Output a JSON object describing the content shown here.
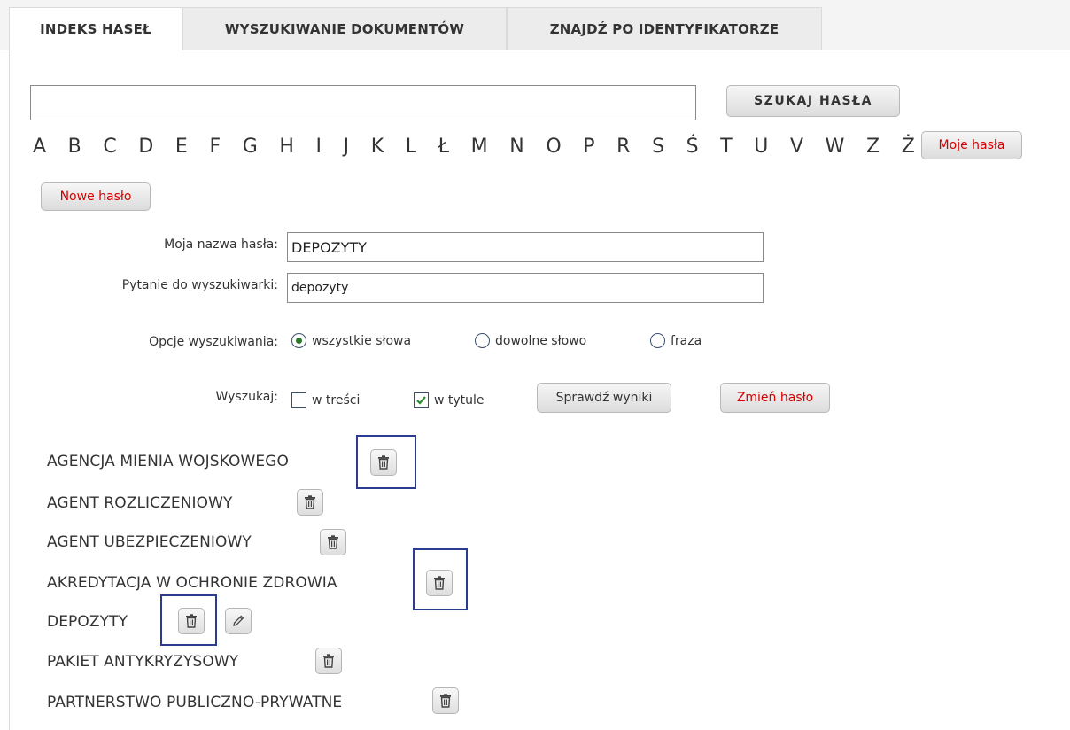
{
  "tabs": [
    {
      "label": "INDEKS HASEŁ",
      "active": true
    },
    {
      "label": "WYSZUKIWANIE DOKUMENTÓW",
      "active": false
    },
    {
      "label": "ZNAJDŹ PO IDENTYFIKATORZE",
      "active": false
    }
  ],
  "search": {
    "value": "",
    "button_label": "SZUKAJ HASŁA"
  },
  "alphabet": [
    "A",
    "B",
    "C",
    "D",
    "E",
    "F",
    "G",
    "H",
    "I",
    "J",
    "K",
    "L",
    "Ł",
    "M",
    "N",
    "O",
    "P",
    "R",
    "S",
    "Ś",
    "T",
    "U",
    "V",
    "W",
    "Z",
    "Ż"
  ],
  "my_entries_button": "Moje hasła",
  "new_entry_button": "Nowe hasło",
  "form": {
    "name_label": "Moja nazwa hasła:",
    "name_value": "DEPOZYTY",
    "query_label": "Pytanie do wyszukiwarki:",
    "query_value": "depozyty",
    "options_label": "Opcje wyszukiwania:",
    "options": [
      {
        "label": "wszystkie słowa",
        "selected": true
      },
      {
        "label": "dowolne słowo",
        "selected": false
      },
      {
        "label": "fraza",
        "selected": false
      }
    ],
    "search_in_label": "Wyszukaj:",
    "search_in": [
      {
        "label": "w treści",
        "checked": false
      },
      {
        "label": "w tytule",
        "checked": true
      }
    ],
    "check_results_button": "Sprawdź wyniki",
    "change_entry_button": "Zmień hasło"
  },
  "entries": [
    {
      "label": "AGENCJA MIENIA WOJSKOWEGO",
      "underlined": false,
      "editable": false
    },
    {
      "label": "AGENT ROZLICZENIOWY",
      "underlined": true,
      "editable": false
    },
    {
      "label": "AGENT UBEZPIECZENIOWY",
      "underlined": false,
      "editable": false
    },
    {
      "label": "AKREDYTACJA W OCHRONIE ZDROWIA",
      "underlined": false,
      "editable": false
    },
    {
      "label": "DEPOZYTY",
      "underlined": false,
      "editable": true
    },
    {
      "label": "PAKIET ANTYKRYZYSOWY",
      "underlined": false,
      "editable": false
    },
    {
      "label": "PARTNERSTWO PUBLICZNO-PRYWATNE",
      "underlined": false,
      "editable": false
    }
  ],
  "icons": {
    "delete": "trash-icon",
    "edit": "pencil-icon",
    "radio_selected": "radio-selected-icon",
    "checkbox_checked": "checkmark-icon"
  },
  "colors": {
    "red_button_text": "#d40000",
    "highlight_box": "#2b3b8f",
    "checkmark": "#2a8a2a"
  }
}
